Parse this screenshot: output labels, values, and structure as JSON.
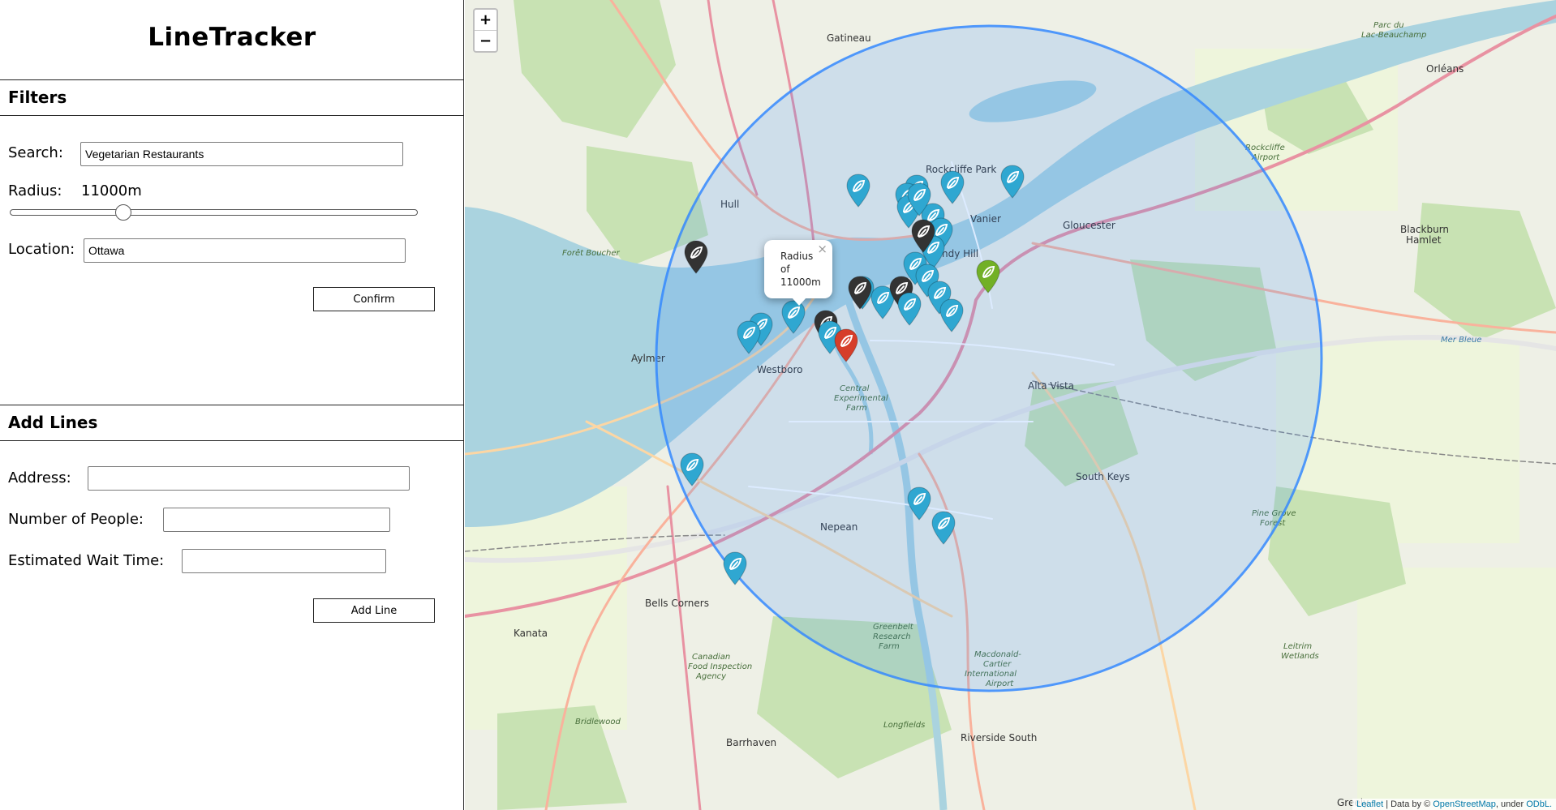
{
  "app": {
    "title": "LineTracker"
  },
  "filters": {
    "header": "Filters",
    "search_label": "Search:",
    "search_value": "Vegetarian Restaurants",
    "radius_label": "Radius:",
    "radius_value": "11000m",
    "radius_slider_fraction": 0.27,
    "location_label": "Location:",
    "location_value": "Ottawa",
    "confirm_label": "Confirm"
  },
  "add_lines": {
    "header": "Add Lines",
    "address_label": "Address:",
    "people_label": "Number of People:",
    "wait_label": "Estimated Wait Time:",
    "add_label": "Add Line"
  },
  "map": {
    "zoom_in": "+",
    "zoom_out": "−",
    "popup_text": "Radius of 11000m",
    "popup_close": "×",
    "attribution_leaflet": "Leaflet",
    "attribution_mid": "| Data by ©",
    "attribution_osm": "OpenStreetMap",
    "attribution_under": ", under",
    "attribution_odbl": "ODbL.",
    "places": [
      "Gatineau",
      "Orléans",
      "Rockcliffe Park",
      "Vanier",
      "Gloucester",
      "Blackburn Hamlet",
      "Hull",
      "Sandy Hill",
      "Aylmer",
      "Westboro",
      "Alta Vista",
      "Central Experimental Farm",
      "Mer Bleue",
      "South Keys",
      "Nepean",
      "Bells Corners",
      "Kanata",
      "Greenbelt Research Farm",
      "Barrhaven",
      "Riverside South",
      "Macdonald-Cartier International Airport",
      "Leitrim Wetlands",
      "Rockcliffe Airport",
      "Parc du Lac-Beauchamp",
      "Pine Grove Forest",
      "Greely",
      "Canadian Food Inspection Agency",
      "Bridlewood",
      "Longfields",
      "Forêt Boucher"
    ],
    "colors": {
      "water": "#aad3df",
      "radius": "#3388ff",
      "marker_blue": "#2fa7d1",
      "marker_dark": "#333333",
      "marker_green": "#72b026",
      "marker_red": "#d63e2a",
      "road_primary": "#d96f6f",
      "park": "#c8e2b3"
    }
  }
}
